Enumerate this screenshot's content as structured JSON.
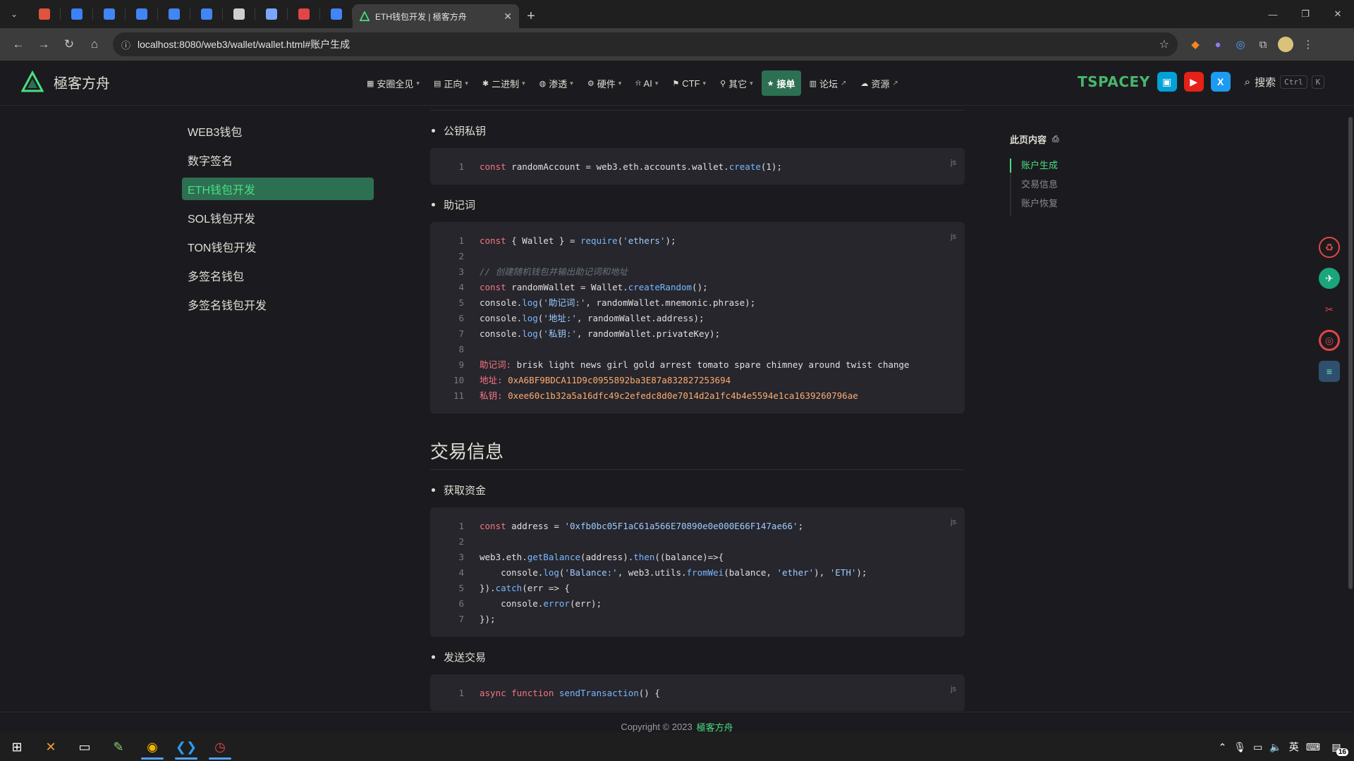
{
  "browser": {
    "active_tab": {
      "title": "ETH钱包开发 | 極客方舟"
    },
    "url": "localhost:8080/web3/wallet/wallet.html#账户生成",
    "pinned_tab_colors": [
      "#e0533d",
      "#3b82f6",
      "#4285f4",
      "#4285f4",
      "#4285f4",
      "#4285f4",
      "#cfcfcf",
      "#7aa7ff",
      "#e04646",
      "#4285f4"
    ]
  },
  "site": {
    "logo_text": "極客方舟",
    "nav": [
      {
        "label": "安圈全见",
        "icon": "grid-icon",
        "caret": true
      },
      {
        "label": "正向",
        "icon": "book-icon",
        "caret": true
      },
      {
        "label": "二进制",
        "icon": "bug-icon",
        "caret": true
      },
      {
        "label": "渗透",
        "icon": "globe-icon",
        "caret": true
      },
      {
        "label": "硬件",
        "icon": "chip-icon",
        "caret": true
      },
      {
        "label": "AI",
        "icon": "ai-icon",
        "caret": true
      },
      {
        "label": "CTF",
        "icon": "flag-icon",
        "caret": true
      },
      {
        "label": "其它",
        "icon": "pin-icon",
        "caret": true
      },
      {
        "label": "接单",
        "icon": "star-icon",
        "caret": false,
        "active": true
      },
      {
        "label": "论坛",
        "icon": "doc-icon",
        "caret": false,
        "external": true
      },
      {
        "label": "资源",
        "icon": "cloud-icon",
        "caret": false,
        "external": true
      }
    ],
    "brand_badge": "TSPACEY",
    "search": {
      "label": "搜索",
      "kbd1": "Ctrl",
      "kbd2": "K"
    }
  },
  "sidebar": {
    "items": [
      {
        "label": "WEB3钱包"
      },
      {
        "label": "数字签名"
      },
      {
        "label": "ETH钱包开发",
        "active": true
      },
      {
        "label": "SOL钱包开发"
      },
      {
        "label": "TON钱包开发"
      },
      {
        "label": "多签名钱包"
      },
      {
        "label": "多签名钱包开发"
      }
    ]
  },
  "content": {
    "sections": [
      {
        "bullet": "公钥私钥",
        "lang": "js",
        "lines": [
          [
            [
              "k",
              "const"
            ],
            [
              "o",
              " randomAccount = web3.eth.accounts.wallet."
            ],
            [
              "f",
              "create"
            ],
            [
              "o",
              "(1);"
            ]
          ]
        ]
      },
      {
        "bullet": "助记词",
        "lang": "js",
        "lines": [
          [
            [
              "k",
              "const"
            ],
            [
              "o",
              " { Wallet } = "
            ],
            [
              "f",
              "require"
            ],
            [
              "o",
              "("
            ],
            [
              "s",
              "'ethers'"
            ],
            [
              "o",
              ");"
            ]
          ],
          [],
          [
            [
              "c",
              "// 创建随机钱包并输出助记词和地址"
            ]
          ],
          [
            [
              "k",
              "const"
            ],
            [
              "o",
              " randomWallet = Wallet."
            ],
            [
              "f",
              "createRandom"
            ],
            [
              "o",
              "();"
            ]
          ],
          [
            [
              "o",
              "console."
            ],
            [
              "f",
              "log"
            ],
            [
              "o",
              "("
            ],
            [
              "s",
              "'助记词:'"
            ],
            [
              "o",
              ", randomWallet.mnemonic.phrase);"
            ]
          ],
          [
            [
              "o",
              "console."
            ],
            [
              "f",
              "log"
            ],
            [
              "o",
              "("
            ],
            [
              "s",
              "'地址:'"
            ],
            [
              "o",
              ", randomWallet.address);"
            ]
          ],
          [
            [
              "o",
              "console."
            ],
            [
              "f",
              "log"
            ],
            [
              "o",
              "("
            ],
            [
              "s",
              "'私钥:'"
            ],
            [
              "o",
              ", randomWallet.privateKey);"
            ]
          ],
          [],
          [
            [
              "out-l",
              "助记词: "
            ],
            [
              "o",
              "brisk light news girl gold arrest tomato spare chimney around twist change"
            ]
          ],
          [
            [
              "out-l",
              "地址: "
            ],
            [
              "out-v",
              "0xA6BF9BDCA11D9c0955892ba3E87a832827253694"
            ]
          ],
          [
            [
              "out-l",
              "私钥: "
            ],
            [
              "out-v",
              "0xee60c1b32a5a16dfc49c2efedc8d0e7014d2a1fc4b4e5594e1ca1639260796ae"
            ]
          ]
        ]
      },
      {
        "heading": "交易信息",
        "bullet": "获取资金",
        "lang": "js",
        "lines": [
          [
            [
              "k",
              "const"
            ],
            [
              "o",
              " address = "
            ],
            [
              "s",
              "'0xfb0bc05F1aC61a566E70890e0e000E66F147ae66'"
            ],
            [
              "o",
              ";"
            ]
          ],
          [],
          [
            [
              "o",
              "web3.eth."
            ],
            [
              "f",
              "getBalance"
            ],
            [
              "o",
              "(address)."
            ],
            [
              "f",
              "then"
            ],
            [
              "o",
              "((balance)=>{"
            ]
          ],
          [
            [
              "o",
              "    console."
            ],
            [
              "f",
              "log"
            ],
            [
              "o",
              "("
            ],
            [
              "s",
              "'Balance:'"
            ],
            [
              "o",
              ", web3.utils."
            ],
            [
              "f",
              "fromWei"
            ],
            [
              "o",
              "(balance, "
            ],
            [
              "s",
              "'ether'"
            ],
            [
              "o",
              "), "
            ],
            [
              "s",
              "'ETH'"
            ],
            [
              "o",
              ");"
            ]
          ],
          [
            [
              "o",
              "})."
            ],
            [
              "f",
              "catch"
            ],
            [
              "o",
              "(err => {"
            ]
          ],
          [
            [
              "o",
              "    console."
            ],
            [
              "f",
              "error"
            ],
            [
              "o",
              "(err);"
            ]
          ],
          [
            [
              "o",
              "});"
            ]
          ]
        ]
      },
      {
        "bullet": "发送交易",
        "lang": "js",
        "lines": [
          [
            [
              "k",
              "async function"
            ],
            [
              "o",
              " "
            ],
            [
              "f",
              "sendTransaction"
            ],
            [
              "o",
              "() {"
            ]
          ]
        ]
      }
    ]
  },
  "aside": {
    "title": "此页内容",
    "items": [
      {
        "label": "账户生成",
        "active": true
      },
      {
        "label": "交易信息"
      },
      {
        "label": "账户恢复"
      }
    ]
  },
  "footer": {
    "prefix": "Copyright © 2023",
    "brand": "極客方舟"
  },
  "taskbar": {
    "tray_lang": "英",
    "notif_count": "16"
  },
  "colors": {
    "accent": "#4ade80",
    "accent_bg": "#2d6f52",
    "bg": "#1b1b1f",
    "code_bg": "#26262c"
  }
}
